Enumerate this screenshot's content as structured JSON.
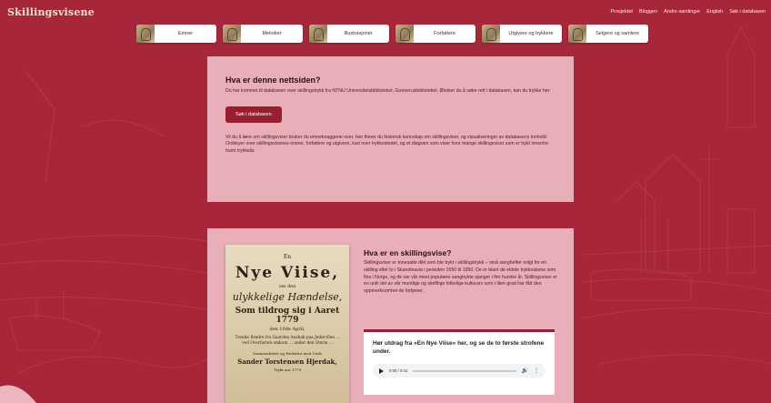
{
  "site": {
    "logo": "Skillingsvisene"
  },
  "topnav": [
    "Prosjektet",
    "Bloggen",
    "Andre samlinger",
    "English",
    "Søk i databasen"
  ],
  "categories": [
    "Emner",
    "Melodier",
    "Illustrasjoner",
    "Forfattere",
    "Utgivere og trykkere",
    "Selgere og samlere"
  ],
  "intro": {
    "title": "Hva er denne nettsiden?",
    "text": "Du har kommet til databasen over skillingstrykk fra NTNU Universitetsbiblioteket, Gunnerusbiblioteket. Ønsker du å søke rett i databasen, kan du trykke her:",
    "button": "Søk i databasen",
    "more": "Vil du å lære om skillingsviser bruker du emneknaggene over. Her finner du historisk kunnskap om skillingsviser, og visualiseringer av databasens innhold: Ordskyer over skillingsvisenes emner, forfattere og utgivere, kart over trykkestedet, og et diagram som viser hvor mange skillingsviser som er trykt innenfor hvert trykkeår."
  },
  "book": {
    "l1": "En",
    "l2": "Nye Viise,",
    "l3": "om den",
    "l4": "ulykkelige Hændelse,",
    "l5": "Som tildrog sig i Aaret 1779",
    "l6": "den 10de April,",
    "l7": "Trende Brødre fra Gaarden Ausbak paa Jeder-Øen ... ved Overfarten omkom ... under den Storm ...",
    "l8": "Sammenfattet og Forfattet med Guds",
    "l9": "Sander Torstensen Hjerdak,",
    "l10": "Trykt aar 1779"
  },
  "skillingsvise": {
    "title": "Hva er en skillingsvise?",
    "text": "Skillingsviser er tonesatte dikt som ble trykt i skillingstrykk – små sanghefter solgt for en skilling eller to i Skandinavia i perioden 1550 til 1950. De er blant de eldste trykksakene som fins i Norge, og de var vår mest populære sangtrykte sjanger i fire hundre år. Skillingsviser er en unik del av vår muntlige og skriftlige folkelige kulturarv som i liten grad har fått den oppmerksomhet de fortjener."
  },
  "audio": {
    "title": "Hør utdrag fra «En Nye Viise» her, og se de to første strofene under.",
    "time": "0:00 / 0:41",
    "progress": 0
  },
  "colors": {
    "background": "#a8263a",
    "accent": "#9a1e32",
    "panel": "#f6ced4"
  }
}
